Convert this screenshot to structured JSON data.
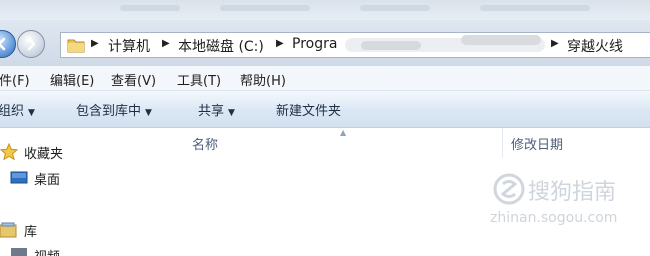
{
  "address": {
    "crumbs": [
      "计算机",
      "本地磁盘 (C:)",
      "Progra",
      "穿越火线"
    ]
  },
  "menubar": {
    "items": [
      "文件(F)",
      "编辑(E)",
      "查看(V)",
      "工具(T)",
      "帮助(H)"
    ]
  },
  "toolbar": {
    "organize": "组织",
    "include_library": "包含到库中",
    "share": "共享",
    "new_folder": "新建文件夹"
  },
  "navpane": {
    "favorites": "收藏夹",
    "desktop": "桌面",
    "libraries": "库",
    "partial": "视频"
  },
  "content": {
    "columns": [
      "名称",
      "修改日期"
    ]
  },
  "watermark": {
    "brand": "搜狗指南",
    "url": "zhinan.sogou.com"
  },
  "colors": {
    "toolbar_gradient_top": "#f4f8fd",
    "toolbar_gradient_bottom": "#d2e0ef",
    "address_bg": "#dfe7f1",
    "header_text": "#4c607a"
  }
}
